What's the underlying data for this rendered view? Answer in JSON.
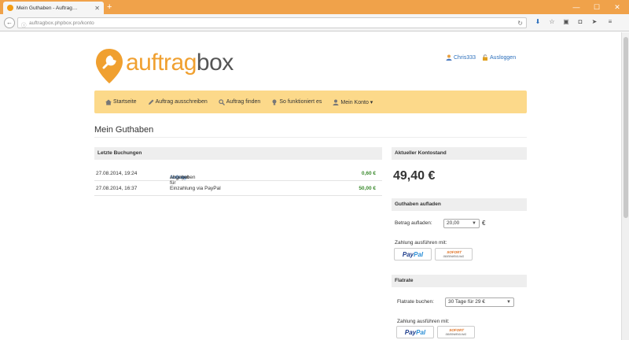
{
  "browser": {
    "tab_title": "Mein Guthaben - Auftrag…",
    "tab_close": "✕",
    "new_tab": "+",
    "url": "auftragbox.phpbox.pro/konto",
    "win_min": "—",
    "win_max": "☐",
    "win_close": "✕"
  },
  "header": {
    "logo_part1": "auftrag",
    "logo_part2": "box",
    "user_name": "Chris333",
    "logout": "Ausloggen"
  },
  "menu": {
    "items": [
      "Startseite",
      "Auftrag ausschreiben",
      "Auftrag finden",
      "So funktioniert es",
      "Mein Konto ▾"
    ]
  },
  "page": {
    "title": "Mein Guthaben"
  },
  "bookings": {
    "heading": "Letzte Buchungen",
    "rows": [
      {
        "date": "27.08.2014, 19:24",
        "desc_pre": "Angebot für ",
        "desc_link": "Auftrag",
        "desc_post": " abgegeben",
        "amount": "0,60 €"
      },
      {
        "date": "27.08.2014, 16:37",
        "desc_pre": "Einzahlung via PayPal",
        "desc_link": "",
        "desc_post": "",
        "amount": "50,00 €"
      }
    ]
  },
  "balance": {
    "heading": "Aktueller Kontostand",
    "value": "49,40 €"
  },
  "topup": {
    "heading": "Guthaben aufladen",
    "label": "Betrag aufladen:",
    "selected": "20,00",
    "currency": "€",
    "pay_label": "Zahlung ausführen mit:"
  },
  "flatrate": {
    "heading": "Flatrate",
    "label": "Flatrate buchen:",
    "selected": "30 Tage für 29 €",
    "pay_label": "Zahlung ausführen mit:"
  },
  "payment": {
    "paypal_1": "Pay",
    "paypal_2": "Pal",
    "sofort_1": "SOFORT",
    "sofort_2": "ÜBERWEISUNG"
  },
  "colors": {
    "accent": "#f0a030",
    "menu_bg": "#fcd98a",
    "link": "#2a6ebb",
    "amount": "#3b8a2e"
  }
}
